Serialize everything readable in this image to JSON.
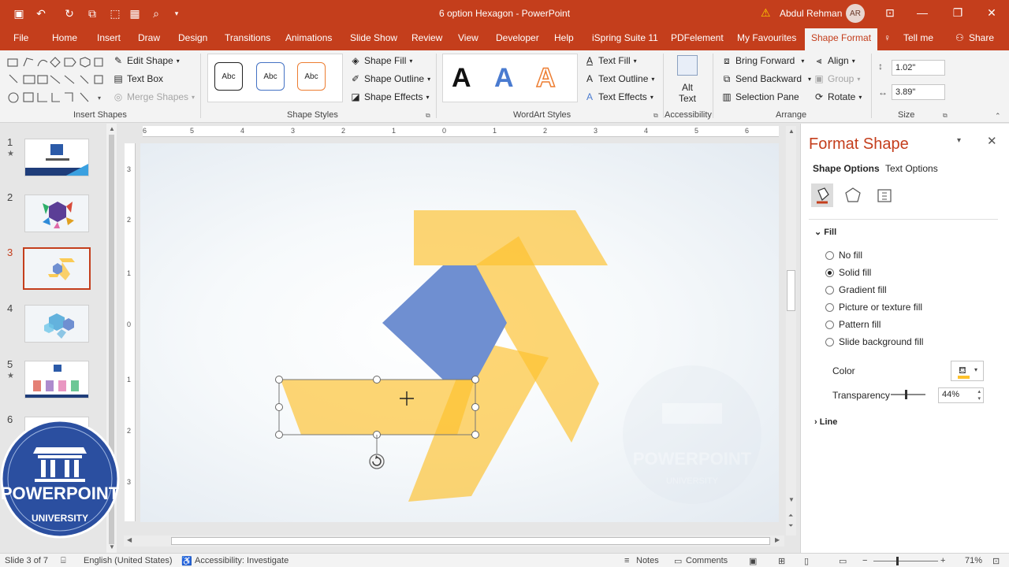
{
  "title_bar": {
    "document_title": "6 option Hexagon - PowerPoint",
    "user_name": "Abdul Rehman",
    "user_initials": "AR"
  },
  "tabs": [
    "File",
    "Home",
    "Insert",
    "Draw",
    "Design",
    "Transitions",
    "Animations",
    "Slide Show",
    "Review",
    "View",
    "Developer",
    "Help",
    "iSpring Suite 11",
    "PDFelement",
    "My Favourites",
    "Shape Format",
    "Tell me",
    "Share"
  ],
  "active_tab": "Shape Format",
  "ribbon": {
    "insert_shapes": {
      "label": "Insert Shapes",
      "edit_shape": "Edit Shape",
      "text_box": "Text Box",
      "merge_shapes": "Merge Shapes"
    },
    "shape_styles": {
      "label": "Shape Styles",
      "swatch_text": "Abc",
      "shape_fill": "Shape Fill",
      "shape_outline": "Shape Outline",
      "shape_effects": "Shape Effects"
    },
    "wordart": {
      "label": "WordArt Styles",
      "glyph": "A",
      "text_fill": "Text Fill",
      "text_outline": "Text Outline",
      "text_effects": "Text Effects"
    },
    "accessibility": {
      "label": "Accessibility",
      "alt_text": "Alt",
      "alt_text2": "Text"
    },
    "arrange": {
      "label": "Arrange",
      "bring_forward": "Bring Forward",
      "send_backward": "Send Backward",
      "selection_pane": "Selection Pane",
      "align": "Align",
      "group": "Group",
      "rotate": "Rotate"
    },
    "size": {
      "label": "Size",
      "height": "1.02\"",
      "width": "3.89\""
    }
  },
  "slides": [
    {
      "num": "1",
      "star": "★"
    },
    {
      "num": "2",
      "star": ""
    },
    {
      "num": "3",
      "star": ""
    },
    {
      "num": "4",
      "star": ""
    },
    {
      "num": "5",
      "star": "★"
    },
    {
      "num": "6",
      "star": ""
    }
  ],
  "active_slide": "3",
  "rulers": {
    "horizontal": [
      "6",
      "5",
      "4",
      "3",
      "2",
      "1",
      "0",
      "1",
      "2",
      "3",
      "4",
      "5",
      "6"
    ],
    "vertical": [
      "3",
      "2",
      "1",
      "0",
      "1",
      "2",
      "3"
    ]
  },
  "format_pane": {
    "title": "Format Shape",
    "tab_shape": "Shape Options",
    "tab_text": "Text Options",
    "fill_section": "Fill",
    "fill_options": [
      "No fill",
      "Solid fill",
      "Gradient fill",
      "Picture or texture fill",
      "Pattern fill",
      "Slide background fill"
    ],
    "selected_fill": "Solid fill",
    "color_label": "Color",
    "transparency_label": "Transparency",
    "transparency_value": "44%",
    "transparency_fraction": 0.44,
    "line_section": "Line"
  },
  "logo": {
    "text": "POWERPOINT",
    "sub": "UNIVERSITY"
  },
  "watermark": {
    "text": "POWERPOINT",
    "sub": "UNIVERSITY"
  },
  "status_bar": {
    "slide_info": "Slide 3 of 7",
    "language": "English (United States)",
    "accessibility": "Accessibility: Investigate",
    "notes": "Notes",
    "comments": "Comments",
    "zoom": "71%"
  },
  "colors": {
    "accent": "#c43e1c",
    "shape_yellow": "#fdc12c",
    "hexagon_blue": "#6f8fd1"
  }
}
